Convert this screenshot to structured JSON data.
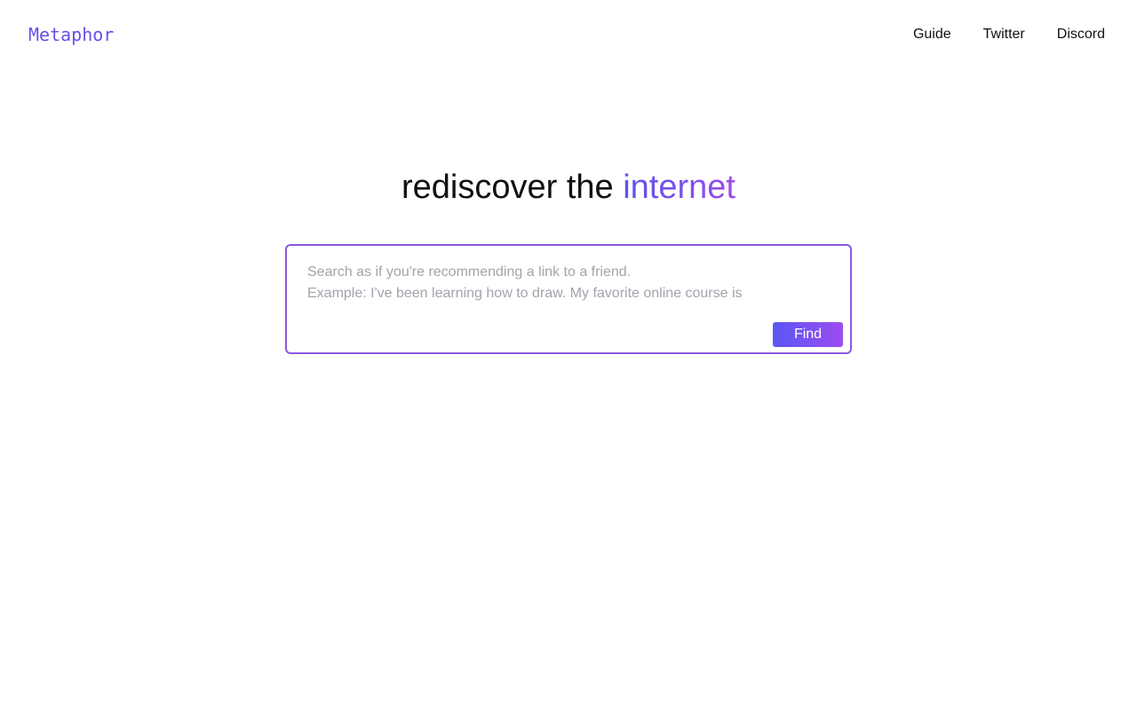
{
  "header": {
    "logo": "Metaphor",
    "nav": [
      {
        "label": "Guide"
      },
      {
        "label": "Twitter"
      },
      {
        "label": "Discord"
      }
    ]
  },
  "hero": {
    "headline_main": "rediscover the ",
    "headline_accent": "internet"
  },
  "search": {
    "placeholder": "Search as if you're recommending a link to a friend.\nExample: I've been learning how to draw. My favorite online course is",
    "value": "",
    "find_label": "Find"
  },
  "colors": {
    "brand": "#6a4ee8",
    "accent_start": "#5b53f0",
    "accent_end": "#9a4de8",
    "border": "#8a58e0",
    "placeholder": "#a3a3ad"
  }
}
